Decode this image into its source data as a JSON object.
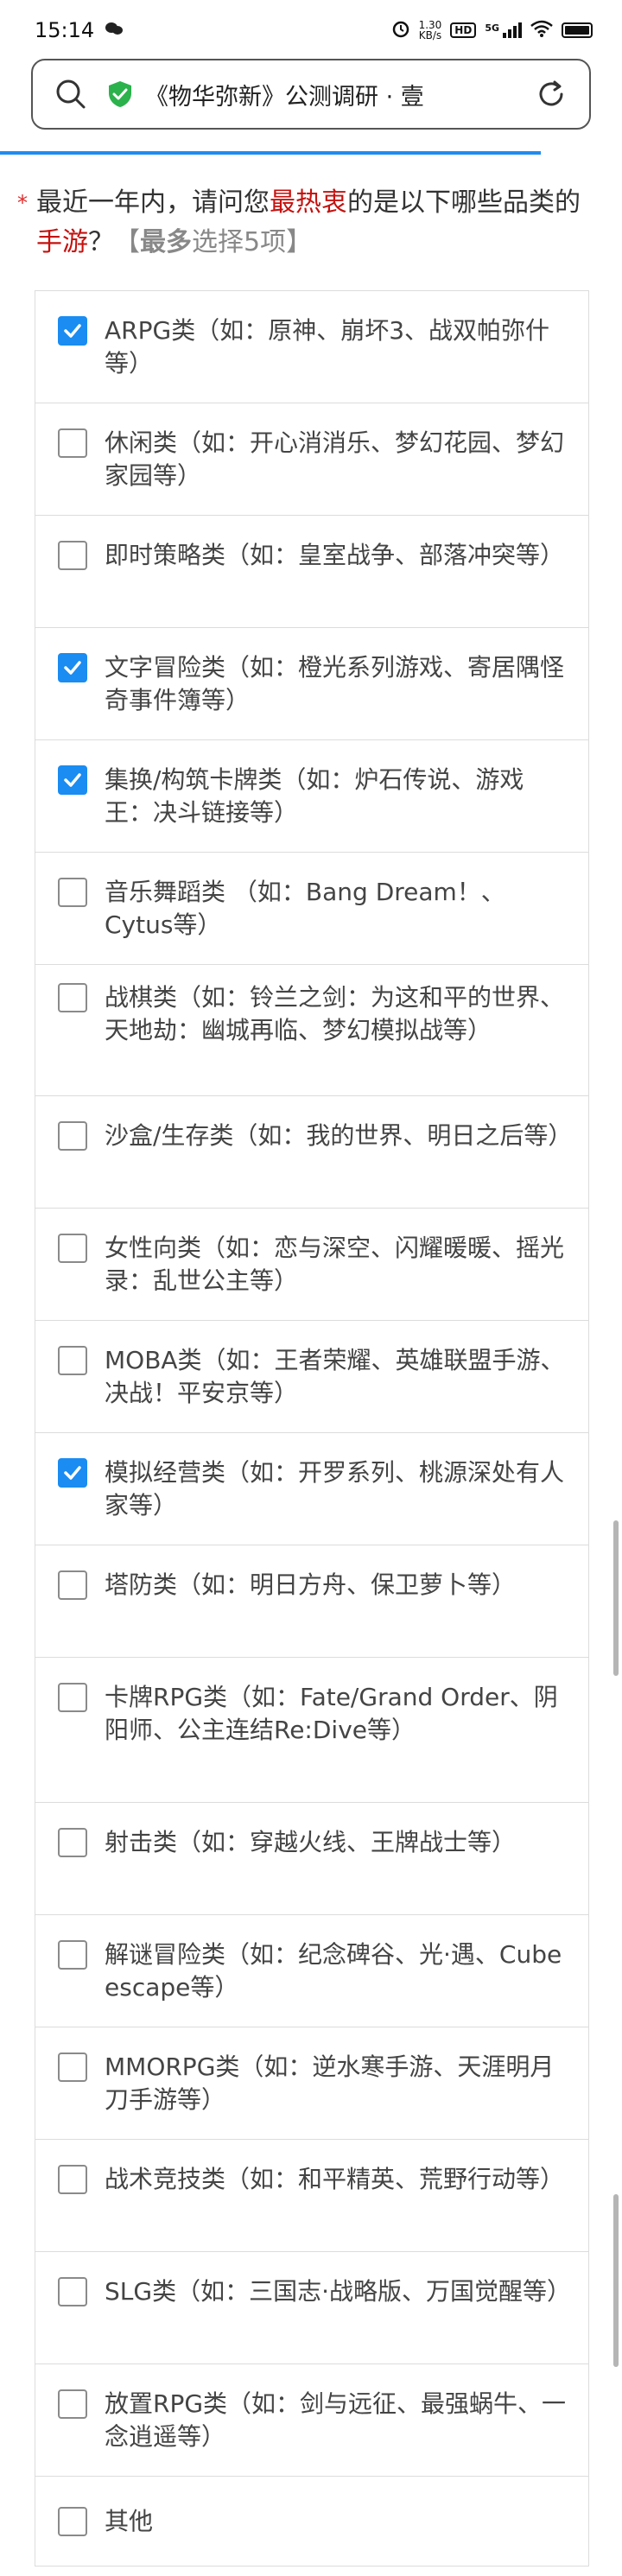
{
  "status_bar": {
    "time": "15:14",
    "net_speed_value": "1.30",
    "net_speed_unit": "KB/s",
    "hd_badge": "HD",
    "signal_label": "5G"
  },
  "url_bar": {
    "title": "《物华弥新》公测调研 · 壹"
  },
  "progress": {
    "fraction": 0.87
  },
  "question": {
    "required_mark": "*",
    "text_before": "最近一年内，请问您",
    "highlight_1": "最热衷",
    "text_middle": "的是以下哪些品类的",
    "highlight_2": "手游",
    "text_after": "？",
    "limit_open": "【",
    "limit_bold": "最多",
    "limit_rest": "选择5项】"
  },
  "options": [
    {
      "label": "ARPG类（如：原神、崩坏3、战双帕弥什等）",
      "checked": true
    },
    {
      "label": "休闲类（如：开心消消乐、梦幻花园、梦幻家园等）",
      "checked": false
    },
    {
      "label": "即时策略类（如：皇室战争、部落冲突等）",
      "checked": false
    },
    {
      "label": "文字冒险类（如：橙光系列游戏、寄居隅怪奇事件簿等）",
      "checked": true
    },
    {
      "label": "集换/构筑卡牌类（如：炉石传说、游戏王：决斗链接等）",
      "checked": true
    },
    {
      "label": "音乐舞蹈类 （如：Bang Dream！、Cytus等）",
      "checked": false
    },
    {
      "label": "战棋类（如：铃兰之剑：为这和平的世界、天地劫：幽城再临、梦幻模拟战等）",
      "checked": false
    },
    {
      "label": "沙盒/生存类（如：我的世界、明日之后等）",
      "checked": false
    },
    {
      "label": "女性向类（如：恋与深空、闪耀暖暖、摇光录：乱世公主等）",
      "checked": false
    },
    {
      "label": "MOBA类（如：王者荣耀、英雄联盟手游、决战！平安京等）",
      "checked": false
    },
    {
      "label": "模拟经营类（如：开罗系列、桃源深处有人家等）",
      "checked": true
    },
    {
      "label": "塔防类（如：明日方舟、保卫萝卜等）",
      "checked": false
    },
    {
      "label": "卡牌RPG类（如：Fate/Grand Order、阴阳师、公主连结Re:Dive等）",
      "checked": false
    },
    {
      "label": "射击类（如：穿越火线、王牌战士等）",
      "checked": false
    },
    {
      "label": "解谜冒险类（如：纪念碑谷、光·遇、Cube escape等）",
      "checked": false
    },
    {
      "label": "MMORPG类（如：逆水寒手游、天涯明月刀手游等）",
      "checked": false
    },
    {
      "label": "战术竞技类（如：和平精英、荒野行动等）",
      "checked": false
    },
    {
      "label": "SLG类（如：三国志·战略版、万国觉醒等）",
      "checked": false
    },
    {
      "label": "放置RPG类（如：剑与远征、最强蜗牛、一念逍遥等）",
      "checked": false
    },
    {
      "label": "其他",
      "checked": false
    }
  ],
  "colors": {
    "accent": "#1a8cf2",
    "highlight_red": "#c4120f",
    "required_red": "#e02b2b",
    "secure_green": "#2bb24c"
  }
}
